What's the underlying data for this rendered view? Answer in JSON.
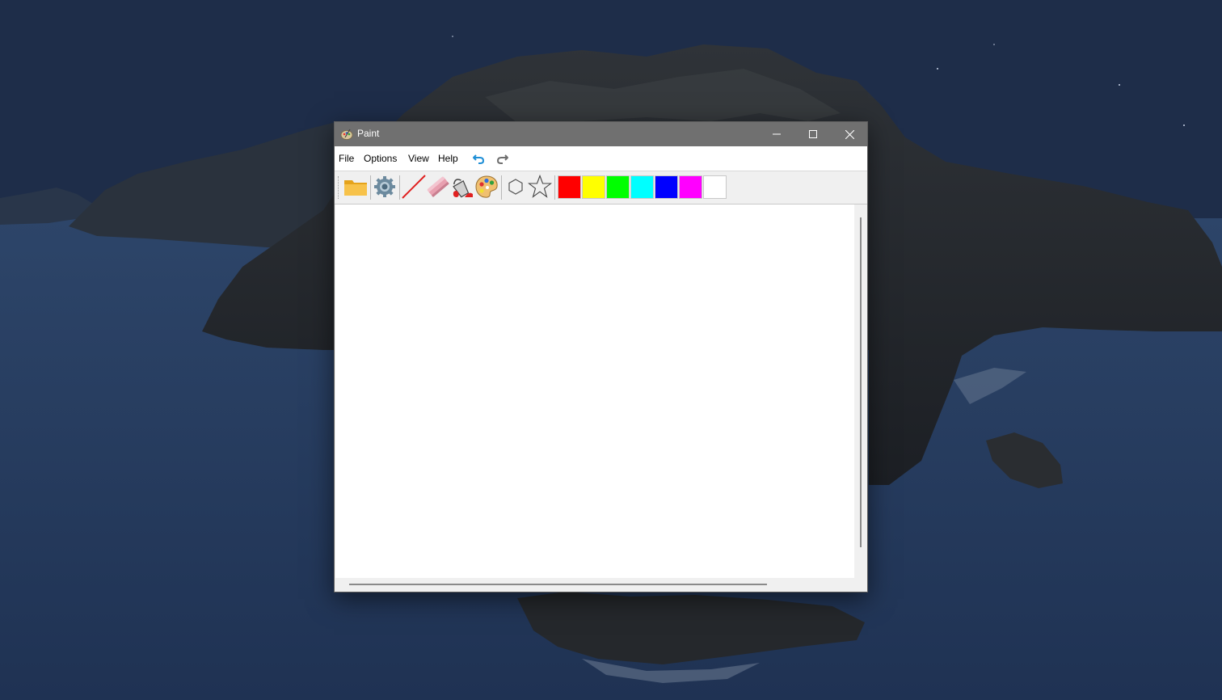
{
  "window": {
    "title": "Paint"
  },
  "menu": {
    "items": [
      "File",
      "Options",
      "View",
      "Help"
    ]
  },
  "toolbar": {
    "tools": [
      "folder-icon",
      "gear-icon",
      "line-icon",
      "eraser-icon",
      "paint-bucket-icon",
      "palette-icon",
      "hexagon-icon",
      "star-icon"
    ],
    "colors": [
      "#FF0000",
      "#FFFF00",
      "#00FF00",
      "#00FFFF",
      "#0000FF",
      "#FF00FF",
      "#FFFFFF"
    ]
  }
}
